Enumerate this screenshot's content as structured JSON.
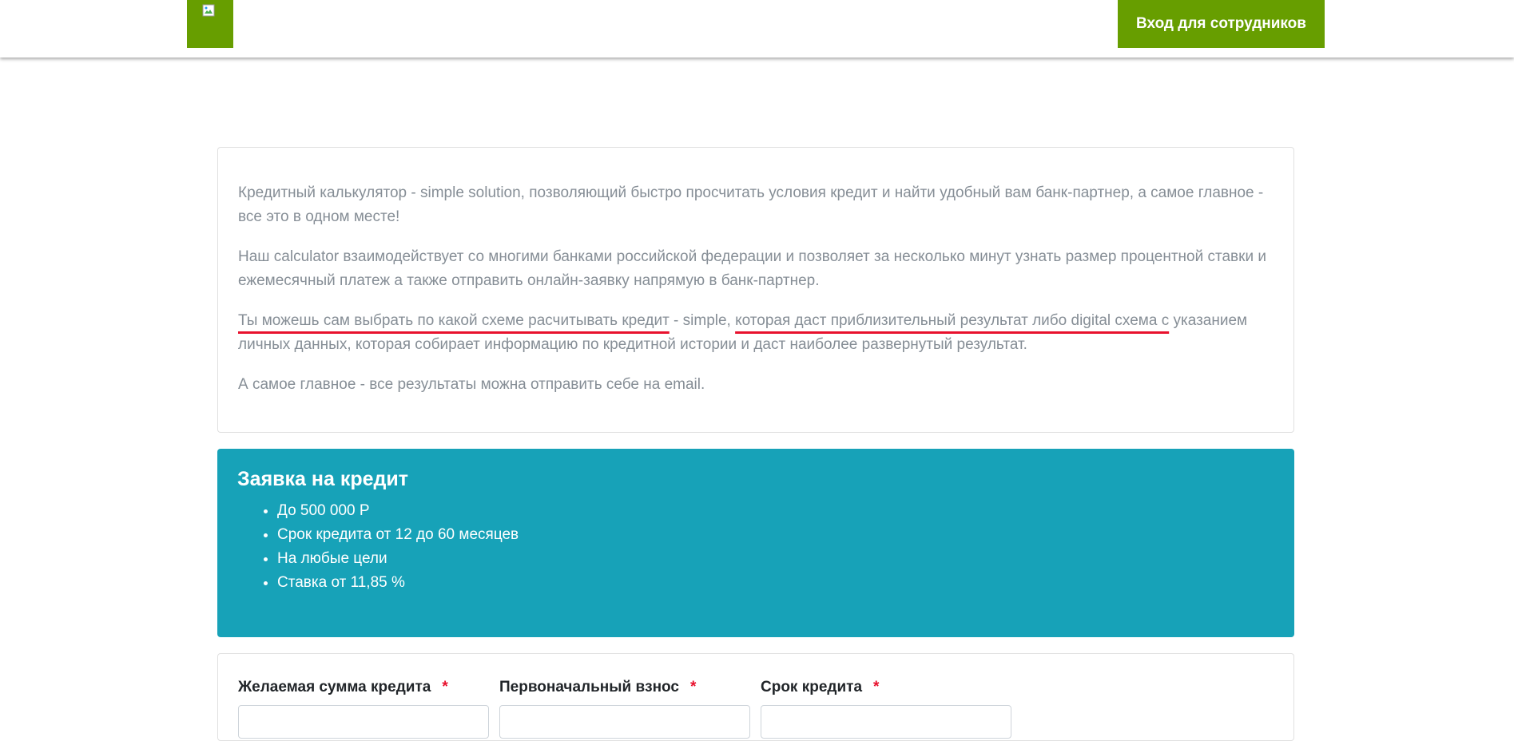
{
  "header": {
    "staff_login": "Вход для сотрудников",
    "brand_color": "#679e00"
  },
  "intro": {
    "p1": "Кредитный калькулятор - simple solution, позволяющий быстро просчитать условия кредит и найти удобный вам банк-партнер, а самое главное - все это в одном месте!",
    "p2": "Наш calculator взаимодействует со многими банками российской федерации и позволяет за несколько минут узнать размер процентной ставки и ежемесячный платеж а также отправить онлайн-заявку напрямую в банк-партнер.",
    "p3_underlined_1": "Ты можешь сам выбрать по какой схеме расчитывать кредит",
    "p3_mid": " - simple, ",
    "p3_underlined_2": "которая даст приблизительный результат либо digital схема с",
    "p3_rest": " указанием личных данных, которая собирает информацию по кредитной истории и даст наиболее развернутый результат.",
    "p4": "А самое главное - все результаты можна отправить себе на email."
  },
  "offer": {
    "title": "Заявка на кредит",
    "items": [
      "До 500 000 Р",
      "Срок кредита от 12 до 60 месяцев",
      "На любые цели",
      "Ставка от 11,85 %"
    ],
    "bg_color": "#17a2b8"
  },
  "form": {
    "amount_label": "Желаемая сумма кредита",
    "down_payment_label": "Первоначальный взнос",
    "term_label": "Срок кредита",
    "required_mark": "*"
  }
}
